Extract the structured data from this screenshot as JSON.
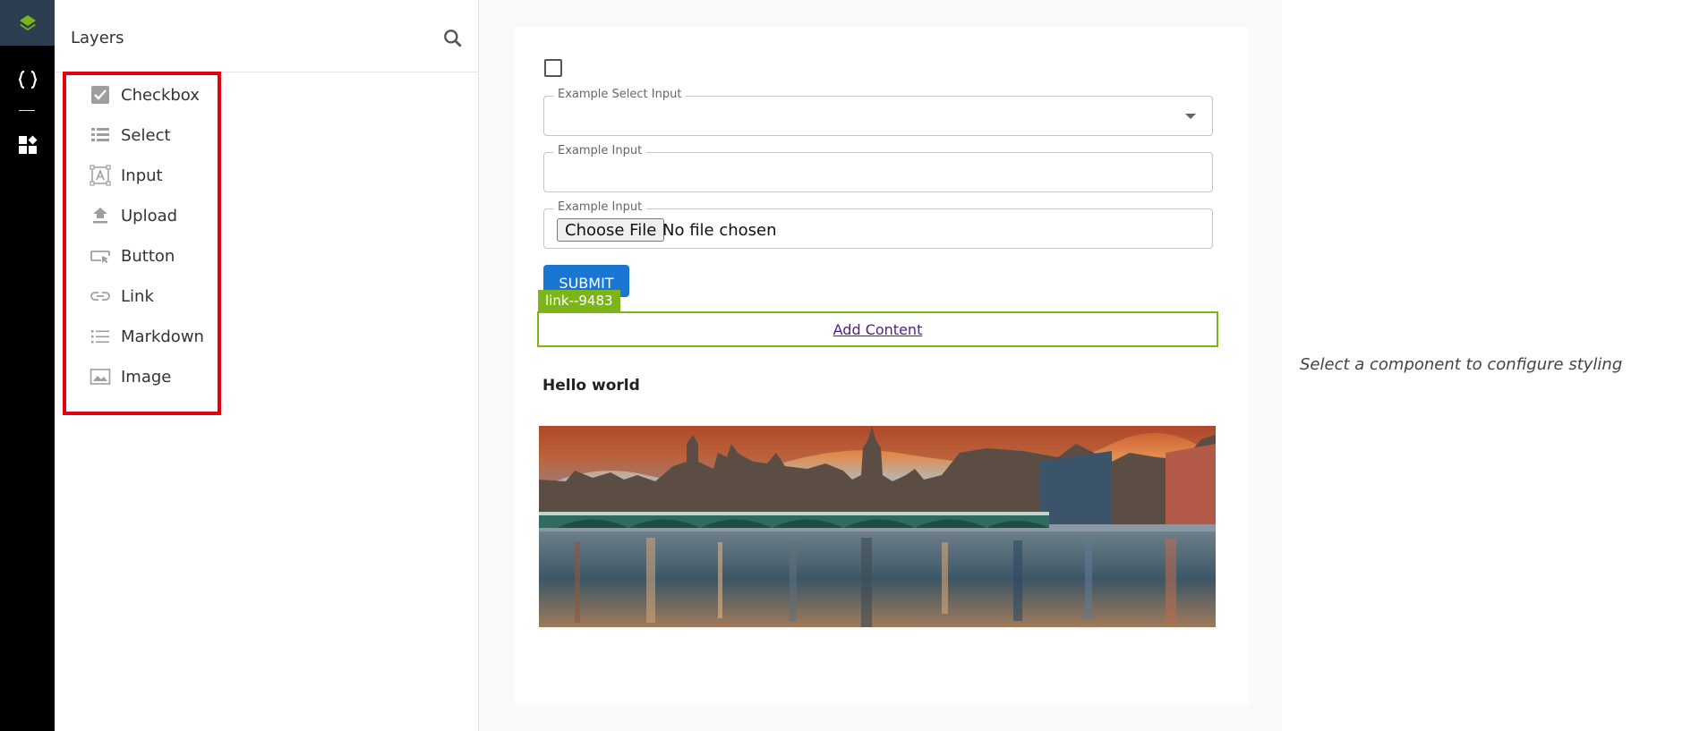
{
  "rail": {
    "items": [
      {
        "name": "layers-logo-icon"
      },
      {
        "name": "code-braces-icon"
      },
      {
        "name": "widgets-icon"
      }
    ]
  },
  "layers_panel": {
    "title": "Layers",
    "search_icon": "search-icon",
    "items": [
      {
        "label": "Checkbox",
        "icon": "checkbox-icon"
      },
      {
        "label": "Select",
        "icon": "list-icon"
      },
      {
        "label": "Input",
        "icon": "text-input-icon"
      },
      {
        "label": "Upload",
        "icon": "upload-icon"
      },
      {
        "label": "Button",
        "icon": "button-icon"
      },
      {
        "label": "Link",
        "icon": "link-icon"
      },
      {
        "label": "Markdown",
        "icon": "markdown-list-icon"
      },
      {
        "label": "Image",
        "icon": "image-icon"
      }
    ],
    "highlight_color": "#e3000f"
  },
  "canvas": {
    "select_label": "Example Select Input",
    "input_label": "Example Input",
    "file_label": "Example Input",
    "file_button": "Choose File",
    "file_status": "No file chosen",
    "submit_label": "SUBMIT",
    "tag_label": "link--9483",
    "link_text": "Add Content",
    "heading": "Hello world",
    "accent_color": "#1976d2",
    "selection_color": "#7cb518"
  },
  "right_panel": {
    "message": "Select a component to configure styling"
  }
}
